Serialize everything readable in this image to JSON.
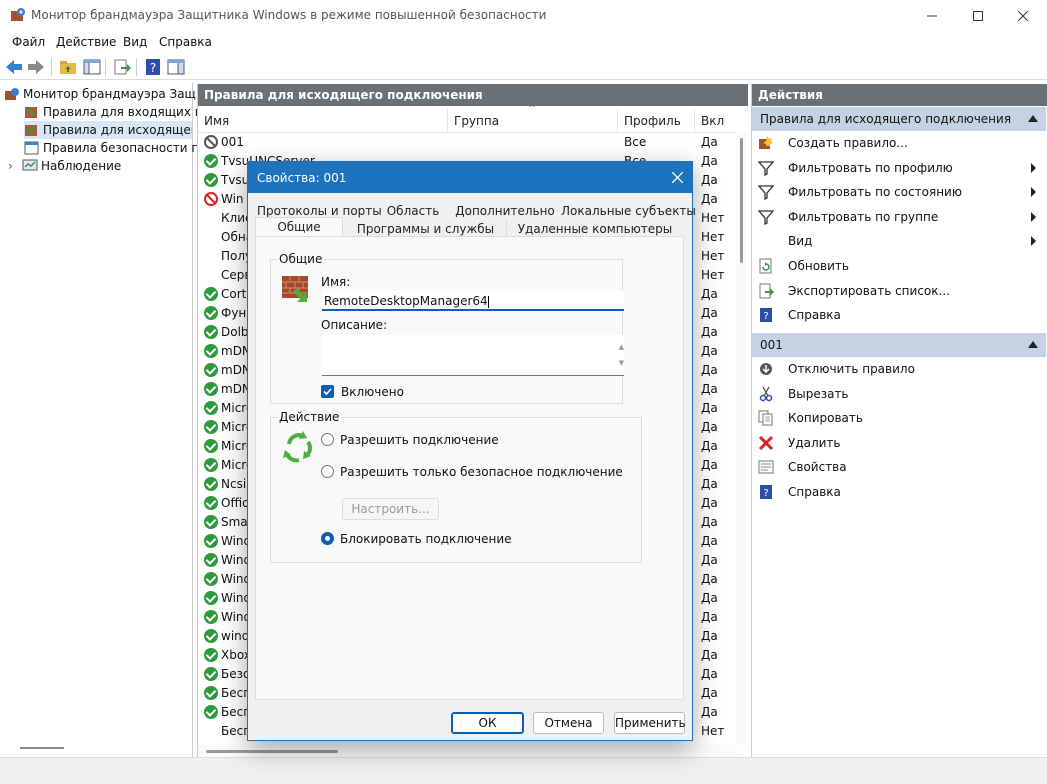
{
  "window": {
    "title": "Монитор брандмауэра Защитника Windows в режиме повышенной безопасности"
  },
  "menu": [
    "Файл",
    "Действие",
    "Вид",
    "Справка"
  ],
  "tree": {
    "root": "Монитор брандмауэра Защит",
    "items": [
      "Правила для входящих по",
      "Правила для исходящего п",
      "Правила безопасности по,",
      "Наблюдение"
    ]
  },
  "center": {
    "header": "Правила для исходящего подключения",
    "columns": [
      "Имя",
      "Группа",
      "Профиль",
      "Вкл"
    ],
    "rows": [
      {
        "icon": "disabled",
        "name": "001",
        "group": "",
        "profile": "Все",
        "enabled": "Да"
      },
      {
        "icon": "ok",
        "name": "TvsuUNCServer",
        "group": "",
        "profile": "Все",
        "enabled": "Да"
      },
      {
        "icon": "ok",
        "name": "TvsuU",
        "group": "",
        "profile": "",
        "enabled": "Да"
      },
      {
        "icon": "block",
        "name": "Win T",
        "group": "",
        "profile": "",
        "enabled": "Да"
      },
      {
        "icon": "none",
        "name": "Клие",
        "group": "",
        "profile": "",
        "enabled": "Нет"
      },
      {
        "icon": "none",
        "name": "Обна",
        "group": "",
        "profile": "",
        "enabled": "Нет"
      },
      {
        "icon": "none",
        "name": "Полу",
        "group": "",
        "profile": "",
        "enabled": "Нет"
      },
      {
        "icon": "none",
        "name": "Серв",
        "group": "",
        "profile": "",
        "enabled": "Нет"
      },
      {
        "icon": "ok",
        "name": "Corta",
        "group": "",
        "profile": "",
        "enabled": "Да"
      },
      {
        "icon": "ok",
        "name": "Функ",
        "group": "",
        "profile": "",
        "enabled": "Да"
      },
      {
        "icon": "ok",
        "name": "Dolby",
        "group": "",
        "profile": "",
        "enabled": "Да"
      },
      {
        "icon": "ok",
        "name": "mDN",
        "group": "",
        "profile": "",
        "enabled": "Да"
      },
      {
        "icon": "ok",
        "name": "mDN",
        "group": "",
        "profile": "",
        "enabled": "Да"
      },
      {
        "icon": "ok",
        "name": "mDN",
        "group": "",
        "profile": "",
        "enabled": "Да"
      },
      {
        "icon": "ok",
        "name": "Micro",
        "group": "",
        "profile": "",
        "enabled": "Да"
      },
      {
        "icon": "ok",
        "name": "Micro",
        "group": "",
        "profile": "",
        "enabled": "Да"
      },
      {
        "icon": "ok",
        "name": "Micro",
        "group": "",
        "profile": "",
        "enabled": "Да"
      },
      {
        "icon": "ok",
        "name": "Micro",
        "group": "",
        "profile": "",
        "enabled": "Да"
      },
      {
        "icon": "ok",
        "name": "Ncsil",
        "group": "",
        "profile": "",
        "enabled": "Да"
      },
      {
        "icon": "ok",
        "name": "Offic",
        "group": "",
        "profile": "",
        "enabled": "Да"
      },
      {
        "icon": "ok",
        "name": "Smar",
        "group": "",
        "profile": "",
        "enabled": "Да"
      },
      {
        "icon": "ok",
        "name": "Wind",
        "group": "",
        "profile": "",
        "enabled": "Да"
      },
      {
        "icon": "ok",
        "name": "Wind",
        "group": "",
        "profile": "",
        "enabled": "Да"
      },
      {
        "icon": "ok",
        "name": "Wind",
        "group": "",
        "profile": "",
        "enabled": "Да"
      },
      {
        "icon": "ok",
        "name": "Wind",
        "group": "",
        "profile": "",
        "enabled": "Да"
      },
      {
        "icon": "ok",
        "name": "Wind",
        "group": "",
        "profile": "",
        "enabled": "Да"
      },
      {
        "icon": "ok",
        "name": "wind",
        "group": "",
        "profile": "",
        "enabled": "Да"
      },
      {
        "icon": "ok",
        "name": "Xbox",
        "group": "",
        "profile": "",
        "enabled": "Да"
      },
      {
        "icon": "ok",
        "name": "Безо",
        "group": "",
        "profile": "",
        "enabled": "Да"
      },
      {
        "icon": "ok",
        "name": "Бесп",
        "group": "",
        "profile": "",
        "enabled": "Да"
      },
      {
        "icon": "ok",
        "name": "Бесп",
        "group": "",
        "profile": "",
        "enabled": "Да"
      },
      {
        "icon": "none",
        "name": "Бесп",
        "group": "",
        "profile": "",
        "enabled": "Нет"
      }
    ]
  },
  "actions": {
    "header": "Действия",
    "section1": "Правила для исходящего подключения",
    "items1": [
      {
        "icon": "new-rule-icon",
        "label": "Создать правило...",
        "submenu": false
      },
      {
        "icon": "filter-icon",
        "label": "Фильтровать по профилю",
        "submenu": true
      },
      {
        "icon": "filter-icon",
        "label": "Фильтровать по состоянию",
        "submenu": true
      },
      {
        "icon": "filter-icon",
        "label": "Фильтровать по группе",
        "submenu": true
      },
      {
        "icon": "none",
        "label": "Вид",
        "submenu": true
      },
      {
        "icon": "refresh-icon",
        "label": "Обновить",
        "submenu": false
      },
      {
        "icon": "export-icon",
        "label": "Экспортировать список...",
        "submenu": false
      },
      {
        "icon": "help-icon",
        "label": "Справка",
        "submenu": false
      }
    ],
    "section2": "001",
    "items2": [
      {
        "icon": "disable-icon",
        "label": "Отключить правило"
      },
      {
        "icon": "cut-icon",
        "label": "Вырезать"
      },
      {
        "icon": "copy-icon",
        "label": "Копировать"
      },
      {
        "icon": "delete-icon",
        "label": "Удалить"
      },
      {
        "icon": "properties-icon",
        "label": "Свойства"
      },
      {
        "icon": "help-icon",
        "label": "Справка"
      }
    ]
  },
  "dialog": {
    "title": "Свойства: 001",
    "tabs_row1": [
      "Протоколы и порты",
      "Область",
      "Дополнительно",
      "Локальные субъекты"
    ],
    "tabs_row2": [
      "Общие",
      "Программы и службы",
      "Удаленные компьютеры"
    ],
    "general": {
      "group_label": "Общие",
      "name_label": "Имя:",
      "name_value": "RemoteDesktopManager64",
      "desc_label": "Описание:",
      "desc_value": "",
      "enabled_label": "Включено",
      "enabled": true
    },
    "action": {
      "group_label": "Действие",
      "options": [
        "Разрешить подключение",
        "Разрешить только безопасное подключение",
        "Блокировать подключение"
      ],
      "selected": 2,
      "customize_label": "Настроить..."
    },
    "buttons": {
      "ok": "ОК",
      "cancel": "Отмена",
      "apply": "Применить"
    }
  }
}
